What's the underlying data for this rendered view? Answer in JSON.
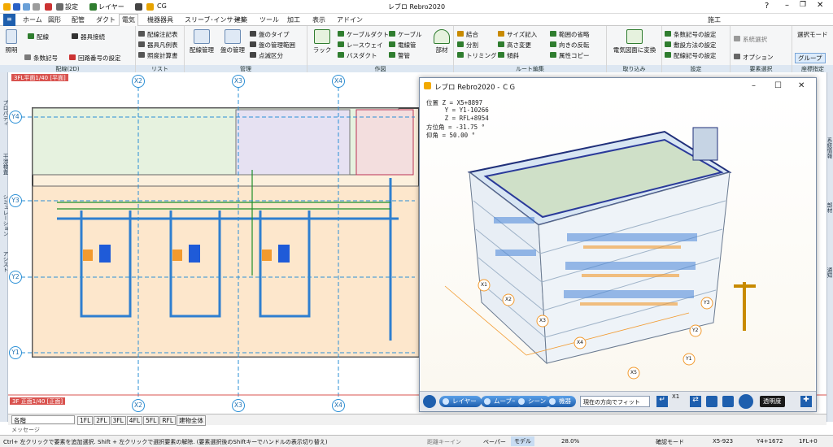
{
  "app": {
    "title": "レブロ Rebro2020",
    "cg_window_title": "レブロ Rebro2020 - ＣＧ"
  },
  "qat": {
    "settings_label": "設定",
    "layer_label": "レイヤー",
    "cg_label": "CG"
  },
  "tabs": [
    "ホーム",
    "図形",
    "配管",
    "ダクト",
    "電気",
    "機器器具",
    "スリーブ･インサート",
    "建築",
    "ツール",
    "加工",
    "表示",
    "アドイン"
  ],
  "active_tab": "電気",
  "right_header": {
    "construct": "施工"
  },
  "ribbon": {
    "g_wiring": {
      "label": "配線(2D)",
      "b1": "照明",
      "b2": "配線",
      "b3": "器具接続",
      "b4": "条数記号",
      "b5": "回路番号の設定"
    },
    "g_list": {
      "label": "リスト",
      "b1": "配線注記表",
      "b2": "器具凡例表",
      "b3": "照度計算書"
    },
    "g_manage": {
      "label": "管理",
      "b1": "配線管理",
      "b2": "盤の管理",
      "b3": "盤のタイプ",
      "b4": "盤の管理範囲",
      "b5": "点滅区分"
    },
    "g_draw": {
      "label": "作図",
      "b1": "ケーブルダクト",
      "b2": "ケーブル",
      "b3": "レースウェイ",
      "b4": "電線管",
      "b5": "バスダクト",
      "b6": "警管",
      "b7": "ラック",
      "b8": "部材"
    },
    "g_route": {
      "label": "ルート編集",
      "b1": "結合",
      "b2": "サイズ記入",
      "b3": "範囲の省略",
      "b4": "分割",
      "b5": "高さ変更",
      "b6": "向きの反転",
      "b7": "トリミング",
      "b8": "傾斜",
      "b9": "属性コピー"
    },
    "g_import": {
      "label": "取り込み",
      "b1": "電気図面に変換"
    },
    "g_settings": {
      "label": "設定",
      "b1": "条数記号の設定",
      "b2": "敷設方法の設定",
      "b3": "配線記号の設定"
    },
    "g_select": {
      "label": "要素選択",
      "b1": "系統選択",
      "b2": "オプション"
    },
    "g_coord": {
      "label": "座標指定",
      "b1": "選択モード",
      "b2": "グループ"
    }
  },
  "left_bar": {
    "top": "記号",
    "items": [
      "プロパティ",
      "干渉検査",
      "シミュレーション",
      "アシスト"
    ]
  },
  "right_bar": {
    "items": [
      "系統情報",
      "部材",
      "通知"
    ]
  },
  "plan_view": {
    "tag_top": "3FL平面1/40 [平面]",
    "tag_bottom": "3F 正面1/40 [正面]",
    "grid_x": [
      "X2",
      "X3",
      "X4"
    ],
    "grid_y": [
      "Y4",
      "Y3",
      "Y2",
      "Y1"
    ]
  },
  "cg": {
    "hud": [
      "位置 Z = X5+8897",
      "     Y = Y1-10266",
      "     Z = RFL+8954",
      "方位角 = -31.75 °",
      "仰角 = 50.00 °"
    ],
    "labels": [
      "X1",
      "X2",
      "X3",
      "X4",
      "X5",
      "Y1",
      "Y2",
      "Y3"
    ],
    "toolbar": {
      "layer": "レイヤー",
      "move": "ムーブー",
      "scene": "シーン",
      "equip": "機器",
      "fit": "現在の方向でフィット",
      "transparency": "透明度",
      "x1": "X1"
    }
  },
  "floors": {
    "combo": "各階",
    "items": [
      "1FL",
      "2FL",
      "3FL",
      "4FL",
      "5FL",
      "RFL",
      "建物全体"
    ]
  },
  "message_label": "メッセージ",
  "status": {
    "hint": "Ctrl+ 左クリックで要素を追加選択. Shift + 左クリックで選択要素の解除. (要素選択後のShiftキーでハンドルの表示切り替え)",
    "distance": "距離キーイン",
    "paper": "ペーパー",
    "model": "モデル",
    "zoom": "28.0%",
    "confirm": "確認モード",
    "x": "X5-923",
    "y": "Y4+1672",
    "z": "1FL+0"
  },
  "colors": {
    "accent": "#1e5fae",
    "ribbon_bg": "#f5f6f7",
    "plan_bg": "#fff7ec",
    "tag": "#d9534f"
  }
}
